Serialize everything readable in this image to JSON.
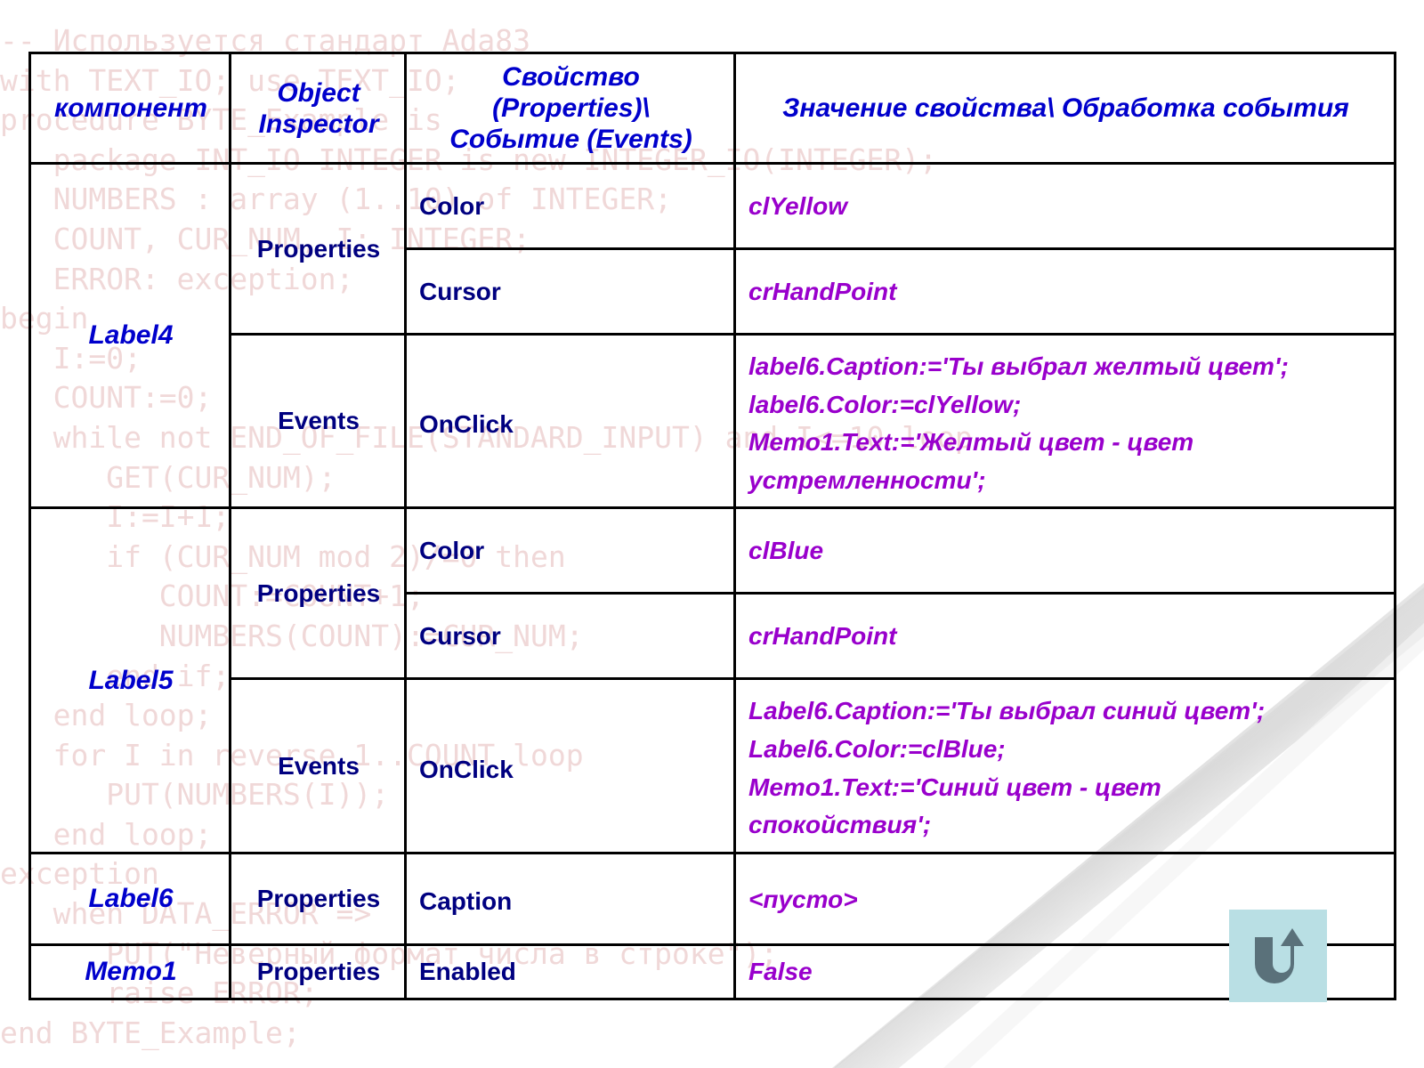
{
  "background_code": "-- Используется стандарт Ada83\nwith TEXT_IO; use TEXT_IO;\nprocedure BYTE_Example is\n   package INT_IO INTEGER is new INTEGER_IO(INTEGER);\n   NUMBERS : array (1..10) of INTEGER;\n   COUNT, CUR_NUM, I: INTEGER;\n   ERROR: exception;\nbegin\n   I:=0;\n   COUNT:=0;\n   while not END_OF_FILE(STANDARD_INPUT) and I<=10 loop\n      GET(CUR_NUM);\n      I:=I+1;\n      if (CUR_NUM mod 2)/=0 then\n         COUNT:=COUNT+1;\n         NUMBERS(COUNT):=CUR_NUM;\n      end if;\n   end loop;\n   for I in reverse 1..COUNT loop\n      PUT(NUMBERS(I));\n   end loop;\nexception\n   when DATA_ERROR =>\n      PUT(\"Неверный формат числа в строке\");\n      raise ERROR;\nend BYTE_Example;",
  "colors": {
    "header_text": "#0000CC",
    "label_text": "#000080",
    "value_text": "#9900CC",
    "border": "#000000",
    "button_bg": "#B9DFE4",
    "button_icon": "#5A717A",
    "watermark": "#F0D8D8"
  },
  "table": {
    "headers": {
      "component": "компонент",
      "object_inspector": "Object\nInspector",
      "object_inspector_line1": "Object",
      "object_inspector_line2": "Inspector",
      "property_event_line1": "Свойство",
      "property_event_line2": "(Properties)\\",
      "property_event_line3": "Событие (Events)",
      "value_handler": "Значение свойства\\ Обработка события"
    },
    "rows": [
      {
        "component": "Label4",
        "groups": [
          {
            "inspector": "Properties",
            "items": [
              {
                "property": "Color",
                "value_lines": [
                  "clYellow"
                ]
              },
              {
                "property": "Cursor",
                "value_lines": [
                  "crHandPoint"
                ]
              }
            ]
          },
          {
            "inspector": "Events",
            "items": [
              {
                "property": "OnClick",
                "value_lines": [
                  "label6.Caption:='Ты выбрал желтый цвет';",
                  "label6.Color:=clYellow;",
                  "Memo1.Text:='Желтый  цвет - цвет",
                  "устремленности';"
                ]
              }
            ]
          }
        ]
      },
      {
        "component": "Label5",
        "groups": [
          {
            "inspector": "Properties",
            "items": [
              {
                "property": "Color",
                "value_lines": [
                  "clBlue"
                ]
              },
              {
                "property": "Cursor",
                "value_lines": [
                  "crHandPoint"
                ]
              }
            ]
          },
          {
            "inspector": "Events",
            "items": [
              {
                "property": "OnClick",
                "value_lines": [
                  "Label6.Caption:='Ты выбрал синий цвет';",
                  "Label6.Color:=clBlue;",
                  "Memo1.Text:='Синий  цвет - цвет",
                  "спокойствия';"
                ]
              }
            ]
          }
        ]
      },
      {
        "component": "Label6",
        "groups": [
          {
            "inspector": "Properties",
            "items": [
              {
                "property": "Caption",
                "value_lines": [
                  "<пусто>"
                ]
              }
            ]
          }
        ]
      },
      {
        "component": "Memo1",
        "groups": [
          {
            "inspector": "Properties",
            "items": [
              {
                "property": "Enabled",
                "value_lines": [
                  "False"
                ]
              }
            ]
          }
        ]
      }
    ]
  },
  "return_button": {
    "icon": "u-turn-arrow-icon",
    "label": ""
  }
}
